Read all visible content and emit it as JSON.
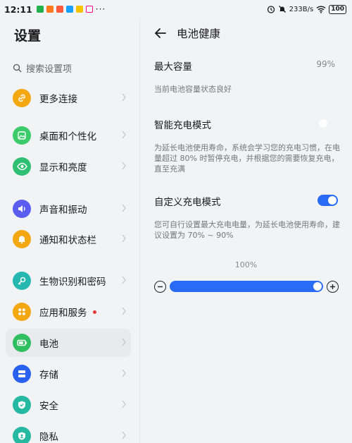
{
  "status_bar": {
    "time": "12:11",
    "more": "···",
    "net_speed": "233B/s",
    "battery": "100"
  },
  "left": {
    "title": "设置",
    "search_placeholder": "搜索设置项",
    "items": [
      {
        "label": "更多连接",
        "icon": "link-icon",
        "color": "#f3a712"
      },
      {
        "label": "桌面和个性化",
        "icon": "wallpaper-icon",
        "color": "#3ccb6a"
      },
      {
        "label": "显示和亮度",
        "icon": "eye-icon",
        "color": "#2fbf72"
      },
      {
        "label": "声音和振动",
        "icon": "speaker-icon",
        "color": "#5b5cf0"
      },
      {
        "label": "通知和状态栏",
        "icon": "bell-icon",
        "color": "#f3a712"
      },
      {
        "label": "生物识别和密码",
        "icon": "key-icon",
        "color": "#26b8b0"
      },
      {
        "label": "应用和服务",
        "icon": "apps-icon",
        "color": "#f3a712"
      },
      {
        "label": "电池",
        "icon": "battery-icon",
        "color": "#2fbf60"
      },
      {
        "label": "存储",
        "icon": "storage-icon",
        "color": "#2a62f0"
      },
      {
        "label": "安全",
        "icon": "shield-icon",
        "color": "#26b8a0"
      },
      {
        "label": "隐私",
        "icon": "privacy-icon",
        "color": "#26b8a0"
      }
    ],
    "selected": "电池"
  },
  "right": {
    "title": "电池健康",
    "max_capacity_label": "最大容量",
    "max_capacity_value": "99%",
    "capacity_status": "当前电池容量状态良好",
    "smart_charge_label": "智能充电模式",
    "smart_charge_on": false,
    "smart_charge_desc": "为延长电池使用寿命，系统会学习您的充电习惯，在电量超过 80% 时暂停充电，并根据您的需要恢复充电，直至充满",
    "custom_charge_label": "自定义充电模式",
    "custom_charge_on": true,
    "custom_charge_desc": "您可自行设置最大充电电量，为延长电池使用寿命，建议设置为 70% ~ 90%",
    "charge_limit_label": "100%",
    "charge_limit_fraction": 1.0
  },
  "colors": {
    "accent": "#2a6bf5",
    "background": "#f2f3f5"
  }
}
